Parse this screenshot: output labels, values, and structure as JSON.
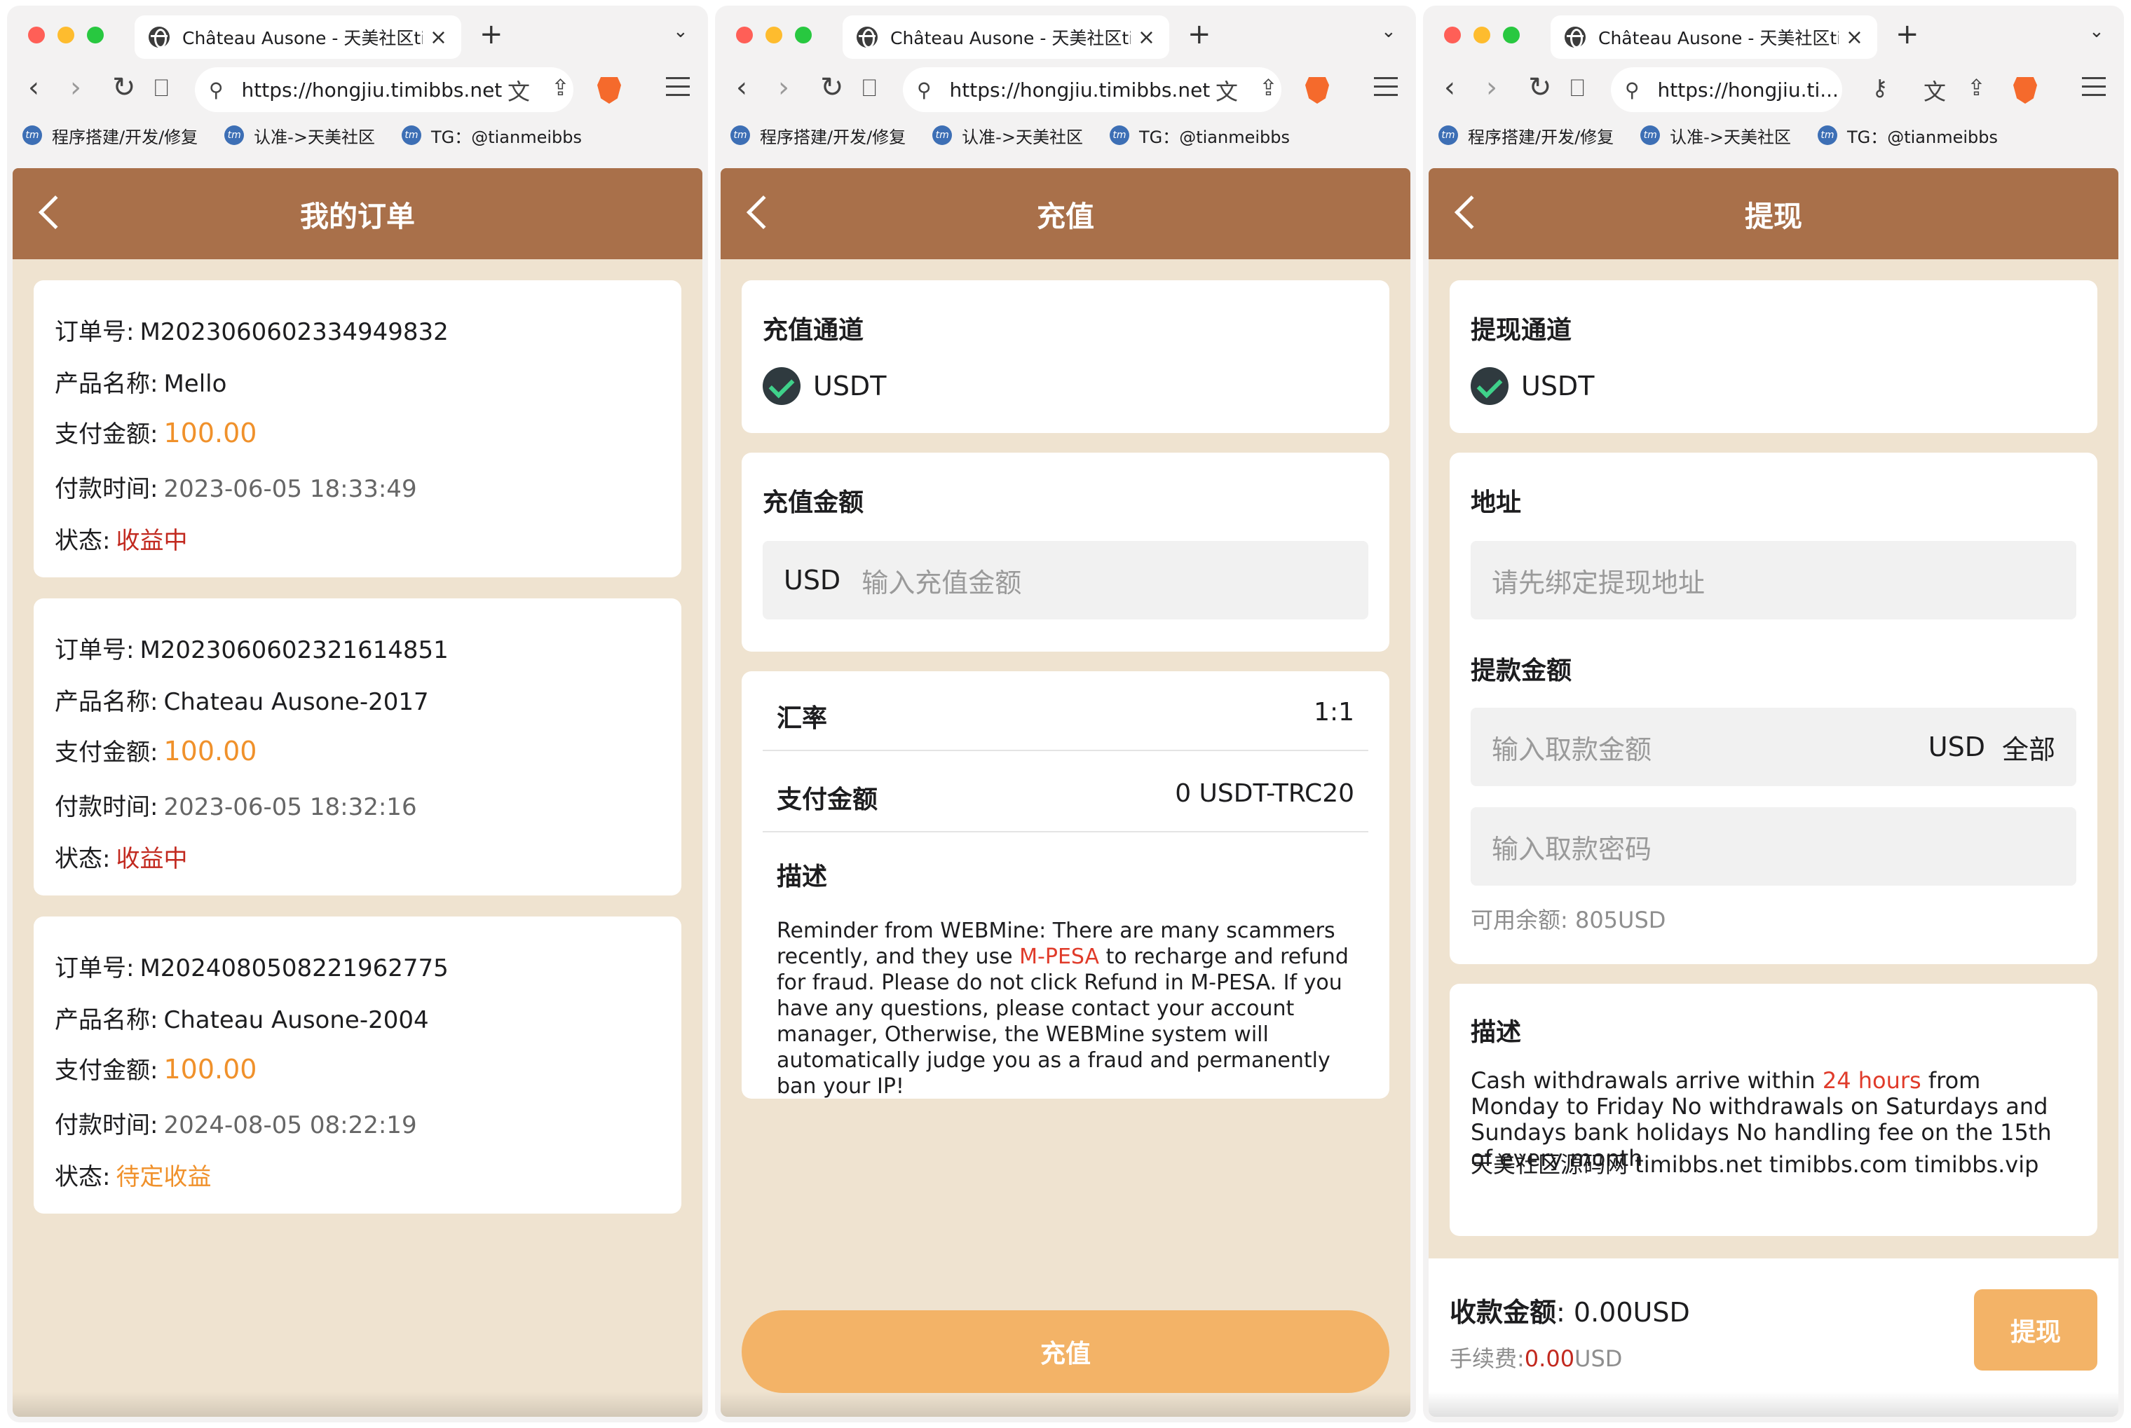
{
  "browser": {
    "tab_title": "Château Ausone - 天美社区timibbs",
    "url": "https://hongjiu.timibbs.net",
    "url_short": "https://hongjiu.ti...",
    "bookmarks": [
      "程序搭建/开发/修复",
      "认准->天美社区",
      "TG：@tianmeibbs"
    ],
    "icons": {
      "globe": "globe-icon",
      "translate": "translate-icon",
      "share": "share-icon",
      "brave": "brave-lion-icon",
      "menu": "hamburger-icon",
      "key": "key-icon"
    }
  },
  "orders_page": {
    "title": "我的订单",
    "labels": {
      "order_no": "订单号:",
      "product": "产品名称:",
      "amount": "支付金额:",
      "time": "付款时间:",
      "status": "状态:"
    },
    "orders": [
      {
        "order_no": "M2023060602334949832",
        "product": "Mello",
        "amount": "100.00",
        "time": "2023-06-05 18:33:49",
        "status": "收益中"
      },
      {
        "order_no": "M2023060602321614851",
        "product": "Chateau Ausone-2017",
        "amount": "100.00",
        "time": "2023-06-05 18:32:16",
        "status": "收益中"
      },
      {
        "order_no": "M2024080508221962775",
        "product": "Chateau Ausone-2004",
        "amount": "100.00",
        "time": "2024-08-05 08:22:19",
        "status": "待定收益"
      }
    ]
  },
  "recharge_page": {
    "title": "充值",
    "channel_title": "充值通道",
    "channel": "USDT",
    "amount_title": "充值金额",
    "currency": "USD",
    "amount_placeholder": "输入充值金额",
    "rate_label": "汇率",
    "rate_value": "1:1",
    "pay_label": "支付金额",
    "pay_value": "0 USDT-TRC20",
    "desc_title": "描述",
    "desc_before": "Reminder from WEBMine: There are many scammers recently, and they use ",
    "desc_highlight": "M-PESA",
    "desc_after": " to recharge and refund for fraud. Please do not click Refund in M-PESA. If you have any questions, please contact your account manager, Otherwise, the WEBMine system will automatically judge you as a fraud and permanently ban your IP!",
    "button": "充值"
  },
  "withdraw_page": {
    "title": "提现",
    "channel_title": "提现通道",
    "channel": "USDT",
    "address_title": "地址",
    "address_placeholder": "请先绑定提现地址",
    "amount_title": "提款金额",
    "amount_placeholder": "输入取款金额",
    "currency": "USD",
    "all_label": "全部",
    "password_placeholder": "输入取款密码",
    "available": "可用余额: 805USD",
    "desc_title": "描述",
    "desc_before": "Cash withdrawals arrive within ",
    "desc_highlight": "24 hours",
    "desc_after": " from Monday to Friday No withdrawals on Saturdays and Sundays bank holidays No handling fee on the 15th of every month",
    "desc_line2": "天美社区源码网 timibbs.net timibbs.com timibbs.vip",
    "receive_label": "收款金额",
    "receive_value": ": 0.00USD",
    "fee_label": "手续费:",
    "fee_value": "0.00",
    "fee_unit": "USD",
    "button": "提现"
  },
  "colors": {
    "header": "#a9704a",
    "page_bg": "#efe3d0",
    "accent_orange": "#f0912b",
    "button": "#f3b367",
    "status_red": "#c2291f"
  }
}
